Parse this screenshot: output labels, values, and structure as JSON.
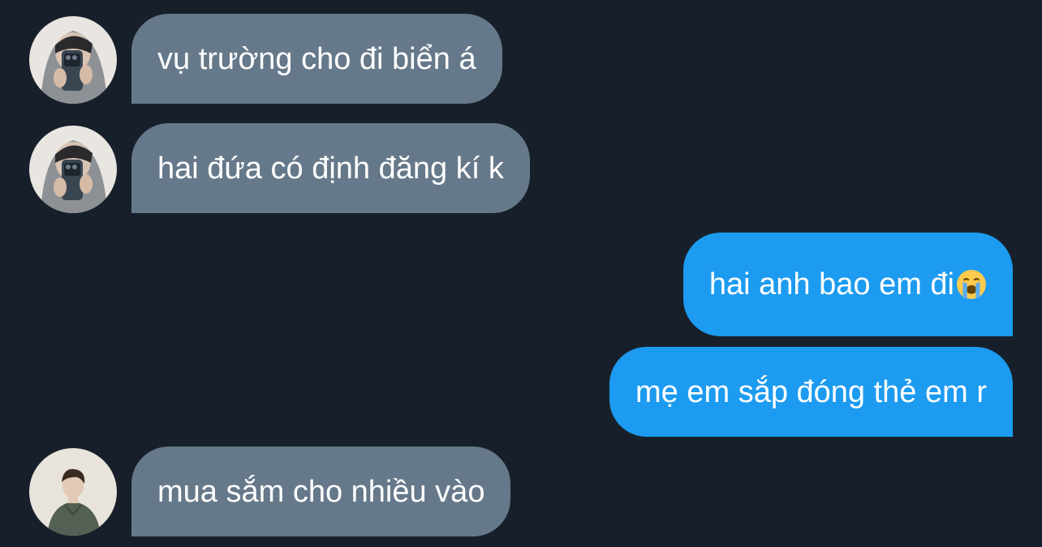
{
  "messages": [
    {
      "id": "m1",
      "direction": "incoming",
      "sender_avatar": "avatar-hooded-mirror-selfie",
      "text": "vụ trường cho đi biển á"
    },
    {
      "id": "m2",
      "direction": "incoming",
      "sender_avatar": "avatar-hooded-mirror-selfie",
      "text": "hai đứa có định đăng kí k"
    },
    {
      "id": "m3",
      "direction": "outgoing",
      "text": "hai anh bao em đi",
      "emoji": "loudly-crying-face"
    },
    {
      "id": "m4",
      "direction": "outgoing",
      "text": "mẹ em sắp đóng thẻ em r"
    },
    {
      "id": "m5",
      "direction": "incoming",
      "sender_avatar": "avatar-person-jacket",
      "text": "mua sắm cho nhiều vào"
    }
  ],
  "colors": {
    "background": "#17202a",
    "incoming_bubble": "#66798a",
    "outgoing_bubble": "#1d9bf0",
    "text": "#ffffff"
  }
}
